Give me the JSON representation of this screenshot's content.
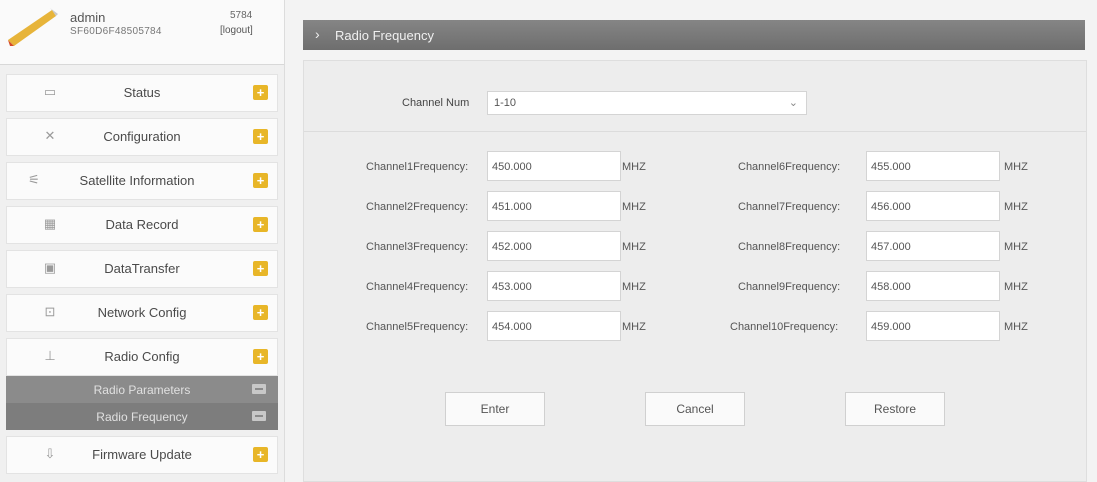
{
  "user": {
    "name": "admin",
    "serial": "SF60D6F48505784",
    "sn_short": "5784",
    "logout": "[logout]"
  },
  "menu": [
    {
      "label": "Status",
      "icon": "monitor-icon"
    },
    {
      "label": "Configuration",
      "icon": "tools-icon"
    },
    {
      "label": "Satellite Information",
      "icon": "satellite-icon"
    },
    {
      "label": "Data Record",
      "icon": "calendar-icon"
    },
    {
      "label": "DataTransfer",
      "icon": "transfer-icon"
    },
    {
      "label": "Network Config",
      "icon": "network-icon"
    },
    {
      "label": "Radio Config",
      "icon": "radio-icon"
    }
  ],
  "submenu": [
    {
      "label": "Radio Parameters"
    },
    {
      "label": "Radio Frequency"
    }
  ],
  "menu_last": {
    "label": "Firmware Update",
    "icon": "upload-icon"
  },
  "header": {
    "title": "Radio Frequency"
  },
  "channel_num": {
    "label": "Channel Num",
    "value": "1-10"
  },
  "left_channels": [
    {
      "label": "Channel1Frequency:",
      "value": "450.000",
      "unit": "MHZ"
    },
    {
      "label": "Channel2Frequency:",
      "value": "451.000",
      "unit": "MHZ"
    },
    {
      "label": "Channel3Frequency:",
      "value": "452.000",
      "unit": "MHZ"
    },
    {
      "label": "Channel4Frequency:",
      "value": "453.000",
      "unit": "MHZ"
    },
    {
      "label": "Channel5Frequency:",
      "value": "454.000",
      "unit": "MHZ"
    }
  ],
  "right_channels": [
    {
      "label": "Channel6Frequency:",
      "value": "455.000",
      "unit": "MHZ"
    },
    {
      "label": "Channel7Frequency:",
      "value": "456.000",
      "unit": "MHZ"
    },
    {
      "label": "Channel8Frequency:",
      "value": "457.000",
      "unit": "MHZ"
    },
    {
      "label": "Channel9Frequency:",
      "value": "458.000",
      "unit": "MHZ"
    },
    {
      "label": "Channel10Frequency:",
      "value": "459.000",
      "unit": "MHZ"
    }
  ],
  "buttons": {
    "enter": "Enter",
    "cancel": "Cancel",
    "restore": "Restore"
  },
  "colors": {
    "plus": "#e8b628",
    "titlebar": "#7a7a7a",
    "submenu": "#8b8b8b"
  }
}
